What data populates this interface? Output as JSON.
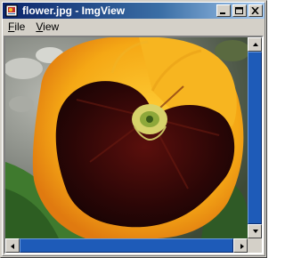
{
  "window": {
    "title": "flower.jpg - ImgView",
    "icon": "image-file-icon",
    "buttons": [
      "minimize-icon",
      "maximize-icon",
      "close-icon"
    ]
  },
  "menubar": {
    "items": [
      {
        "label": "File",
        "accel": "F",
        "rest": "ile"
      },
      {
        "label": "View",
        "accel": "V",
        "rest": "iew"
      }
    ]
  },
  "image": {
    "subject": "yellow pansy flower with dark maroon center blotch",
    "colors": {
      "petal": "#f5b21a",
      "blotch": "#3a0a08",
      "leaf": "#3f7a2e",
      "background": "#8a8d86"
    }
  },
  "scrollbars": {
    "vertical_thumb_fraction": 0.92,
    "horizontal_thumb_fraction": 0.93
  }
}
